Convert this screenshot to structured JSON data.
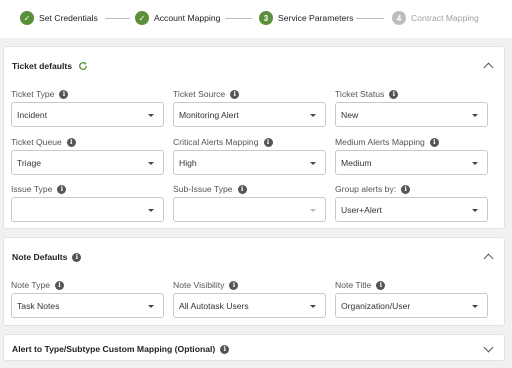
{
  "stepper": {
    "steps": [
      {
        "label": "Set Credentials",
        "state": "done",
        "symbol": "✓"
      },
      {
        "label": "Account Mapping",
        "state": "done",
        "symbol": "✓"
      },
      {
        "label": "Service Parameters",
        "state": "active",
        "symbol": "3"
      },
      {
        "label": "Contract Mapping",
        "state": "pending",
        "symbol": "4"
      }
    ]
  },
  "ticket_defaults": {
    "title": "Ticket defaults",
    "fields": {
      "ticket_type": {
        "label": "Ticket Type",
        "value": "Incident"
      },
      "ticket_source": {
        "label": "Ticket Source",
        "value": "Monitoring Alert"
      },
      "ticket_status": {
        "label": "Ticket Status",
        "value": "New"
      },
      "ticket_queue": {
        "label": "Ticket Queue",
        "value": "Triage"
      },
      "critical_alerts": {
        "label": "Critical Alerts Mapping",
        "value": "High"
      },
      "medium_alerts": {
        "label": "Medium Alerts Mapping",
        "value": "Medium"
      },
      "issue_type": {
        "label": "Issue Type",
        "value": ""
      },
      "sub_issue_type": {
        "label": "Sub-Issue Type",
        "value": ""
      },
      "group_alerts": {
        "label": "Group alerts by:",
        "value": "User+Alert"
      }
    }
  },
  "note_defaults": {
    "title": "Note Defaults",
    "fields": {
      "note_type": {
        "label": "Note Type",
        "value": "Task Notes"
      },
      "note_visibility": {
        "label": "Note Visibility",
        "value": "All Autotask Users"
      },
      "note_title": {
        "label": "Note Title",
        "value": "Organization/User"
      }
    }
  },
  "custom_mapping": {
    "title": "Alert to Type/Subtype Custom Mapping (Optional)"
  },
  "colors": {
    "accent_green": "#5a8f3b",
    "pending_gray": "#bdbdbd"
  },
  "icons": {
    "info": "i",
    "refresh": "refresh-icon",
    "chevron_up": "chevron-up-icon",
    "chevron_down": "chevron-down-icon"
  }
}
